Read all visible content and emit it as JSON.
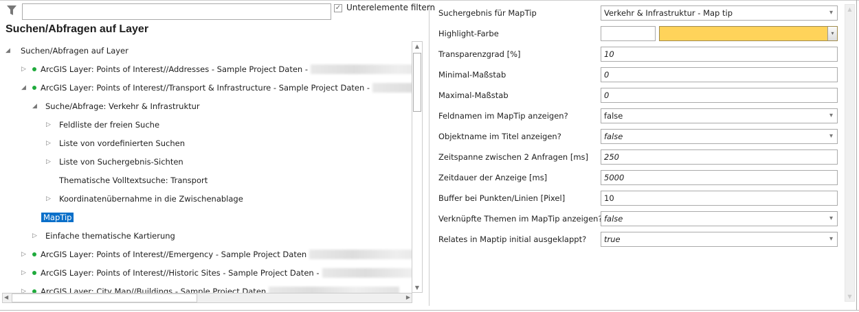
{
  "filter": {
    "value": "",
    "checkbox_label": "Unterelemente filtern",
    "checked": true
  },
  "title": "Suchen/Abfragen auf Layer",
  "tree": [
    {
      "label": "Suchen/Abfragen auf Layer",
      "level": 0,
      "state": "expanded"
    },
    {
      "label": "ArcGIS Layer: Points of Interest//Addresses - Sample Project Daten -",
      "level": 1,
      "state": "collapsed",
      "dot": true
    },
    {
      "label": "ArcGIS Layer: Points of Interest//Transport & Infrastructure - Sample Project Daten -",
      "level": 1,
      "state": "expanded",
      "dot": true
    },
    {
      "label": "Suche/Abfrage: Verkehr & Infrastruktur",
      "level": 2,
      "state": "expanded"
    },
    {
      "label": "Feldliste der freien Suche",
      "level": 3,
      "state": "collapsed"
    },
    {
      "label": "Liste von vordefinierten Suchen",
      "level": 3,
      "state": "collapsed"
    },
    {
      "label": "Liste von Suchergebnis-Sichten",
      "level": 3,
      "state": "collapsed"
    },
    {
      "label": "Thematische Volltextsuche: Transport",
      "level": 3,
      "state": "leaf"
    },
    {
      "label": "Koordinatenübernahme in die Zwischenablage",
      "level": 3,
      "state": "collapsed"
    },
    {
      "label": "MapTip",
      "level": 2,
      "state": "selected"
    },
    {
      "label": "Einfache thematische Kartierung",
      "level": 2,
      "state": "collapsed"
    },
    {
      "label": "ArcGIS Layer: Points of Interest//Emergency - Sample Project Daten",
      "level": 1,
      "state": "collapsed",
      "dot": true
    },
    {
      "label": "ArcGIS Layer: Points of Interest//Historic Sites - Sample Project Daten -",
      "level": 1,
      "state": "collapsed",
      "dot": true
    },
    {
      "label": "ArcGIS Layer: City Map//Buildings - Sample Project Daten",
      "level": 1,
      "state": "collapsed",
      "dot": true
    }
  ],
  "properties": [
    {
      "label": "Suchergebnis für MapTip",
      "value": "Verkehr & Infrastruktur - Map tip",
      "type": "dropdown",
      "italic": false
    },
    {
      "label": "Highlight-Farbe",
      "value": "",
      "type": "color",
      "color": "#ffd35a"
    },
    {
      "label": "Transparenzgrad [%]",
      "value": "10",
      "type": "text",
      "italic": true
    },
    {
      "label": "Minimal-Maßstab",
      "value": "0",
      "type": "text",
      "italic": true
    },
    {
      "label": "Maximal-Maßstab",
      "value": "0",
      "type": "text",
      "italic": true
    },
    {
      "label": "Feldnamen im MapTip anzeigen?",
      "value": "false",
      "type": "dropdown",
      "italic": false
    },
    {
      "label": "Objektname im Titel anzeigen?",
      "value": "false",
      "type": "dropdown",
      "italic": true
    },
    {
      "label": "Zeitspanne zwischen 2 Anfragen [ms]",
      "value": "250",
      "type": "text",
      "italic": true
    },
    {
      "label": "Zeitdauer der Anzeige [ms]",
      "value": "5000",
      "type": "text",
      "italic": true
    },
    {
      "label": "Buffer bei Punkten/Linien [Pixel]",
      "value": "10",
      "type": "text",
      "italic": false
    },
    {
      "label": "Verknüpfte Themen im MapTip anzeigen?",
      "value": "false",
      "type": "dropdown",
      "italic": true
    },
    {
      "label": "Relates in Maptip initial ausgeklappt?",
      "value": "true",
      "type": "dropdown",
      "italic": true
    }
  ],
  "colors": {
    "accent": "#0a6fc9",
    "status_dot": "#1faa3c",
    "highlight": "#ffd35a"
  }
}
